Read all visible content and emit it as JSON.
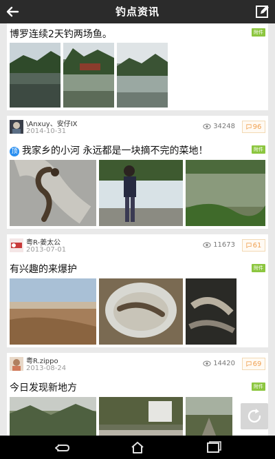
{
  "header": {
    "title": "钓点资讯",
    "back_icon": "back-arrow-icon",
    "edit_icon": "edit-icon"
  },
  "posts": [
    {
      "title": "博罗连续2天钓两场鱼。",
      "attachment_badge": "附件"
    },
    {
      "author": "\\Anxuy、安仔IX",
      "date": "2014-10-31",
      "views": "34248",
      "comments": "96",
      "tag": "顶",
      "title": "我家乡的小河 永远都是一块摘不完的菜地！",
      "attachment_badge": "附件"
    },
    {
      "author": "粤R-姜太公",
      "date": "2013-07-01",
      "views": "11673",
      "comments": "61",
      "title": "有兴趣的来爆护",
      "attachment_badge": "附件"
    },
    {
      "author": "粤R.zippo",
      "date": "2013-08-24",
      "views": "14420",
      "comments": "69",
      "title": "今日发现新地方",
      "attachment_badge": "附件"
    }
  ],
  "colors": {
    "topbar": "#2b2b2b",
    "attachment": "#8cc63f",
    "comment_accent": "#f0a050",
    "background": "#e9e9e9"
  },
  "navbar": {
    "icons": [
      "back-nav-icon",
      "home-nav-icon",
      "recent-apps-icon"
    ]
  }
}
